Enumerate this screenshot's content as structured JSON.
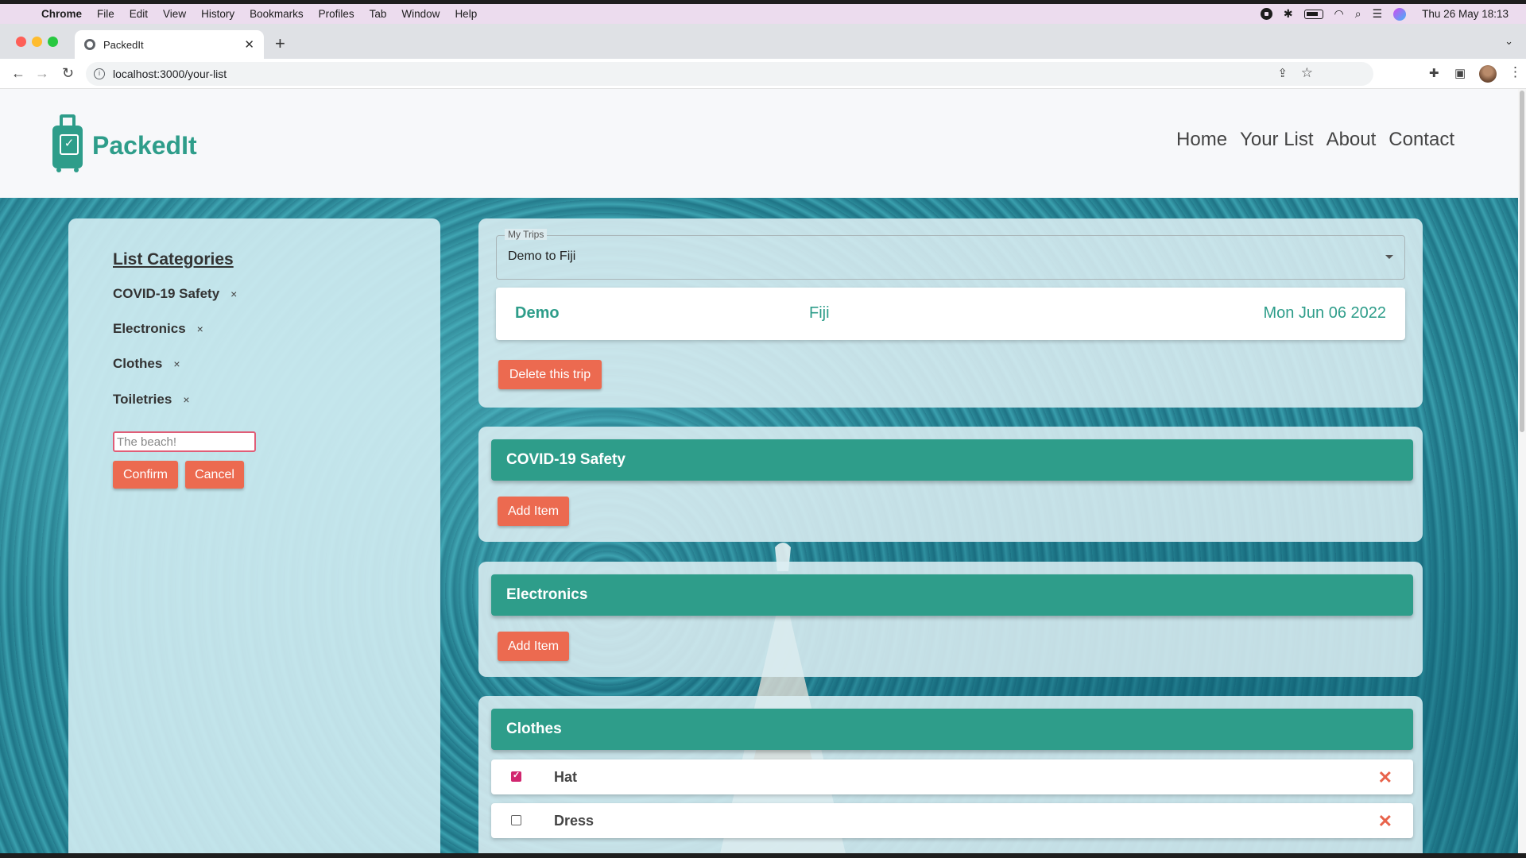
{
  "menubar": {
    "app": "Chrome",
    "items": [
      "File",
      "Edit",
      "View",
      "History",
      "Bookmarks",
      "Profiles",
      "Tab",
      "Window",
      "Help"
    ],
    "clock": "Thu 26 May  18:13"
  },
  "browser": {
    "tab_title": "PackedIt",
    "url": "localhost:3000/your-list"
  },
  "site": {
    "logo_text": "PackedIt",
    "nav": [
      "Home",
      "Your List",
      "About",
      "Contact"
    ]
  },
  "sidebar": {
    "heading": "List Categories",
    "categories": [
      "COVID-19 Safety",
      "Electronics",
      "Clothes",
      "Toiletries"
    ],
    "remove_glyph": "×",
    "new_category_value": "The beach!",
    "confirm_label": "Confirm",
    "cancel_label": "Cancel"
  },
  "trips": {
    "select_label": "My Trips",
    "selected": "Demo to Fiji",
    "card": {
      "name": "Demo",
      "destination": "Fiji",
      "date": "Mon Jun 06 2022"
    },
    "delete_label": "Delete this trip"
  },
  "category_panels": [
    {
      "title": "COVID-19 Safety",
      "add_label": "Add Item"
    },
    {
      "title": "Electronics",
      "add_label": "Add Item"
    },
    {
      "title": "Clothes",
      "items": [
        {
          "label": "Hat",
          "checked": true
        },
        {
          "label": "Dress",
          "checked": false
        }
      ]
    }
  ],
  "icons": {
    "remove_item": "✕"
  },
  "colors": {
    "brand": "#2e9d8a",
    "button": "#ec6a50",
    "checkbox_checked": "#d1266f"
  }
}
